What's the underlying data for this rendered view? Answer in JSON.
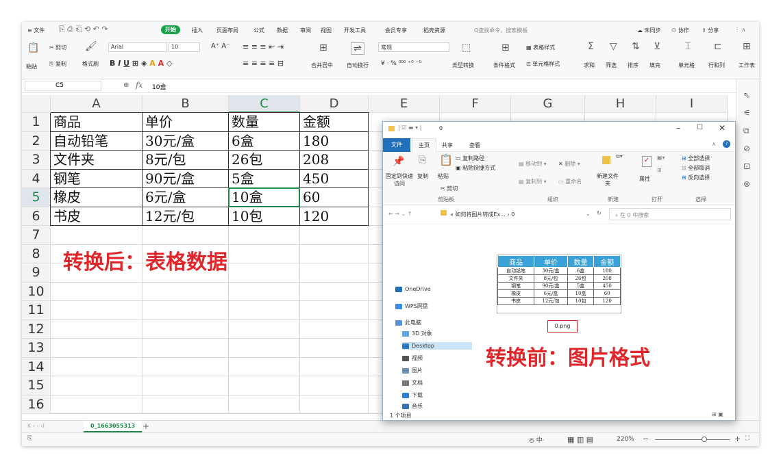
{
  "menubar": {
    "file_label": "≡ 文件",
    "start_label": "开始",
    "items": [
      "插入",
      "页面布局",
      "公式",
      "数据",
      "审阅",
      "视图",
      "开发工具",
      "会员专享",
      "稻壳资源"
    ],
    "search_placeholder": "Q查找命令、搜索模板",
    "sync_label": "未同步",
    "collab_label": "协作",
    "share_label": "分享"
  },
  "ribbon": {
    "paste_label": "粘贴",
    "cut_label": "剪切",
    "copy_label": "复制",
    "format_painter_label": "格式刷",
    "font_name": "Arial",
    "font_size": "10",
    "merge_label": "合并居中",
    "wrap_label": "自动换行",
    "number_format": "常规",
    "type_convert_label": "类型转换",
    "cond_format_label": "条件格式",
    "table_style_label": "表格样式",
    "cell_style_label": "单元格样式",
    "sum_label": "求和",
    "filter_label": "筛选",
    "sort_label": "排序",
    "fill_label": "填充",
    "cell_label": "单元格",
    "rowcol_label": "行和列",
    "worksheet_label": "工作表"
  },
  "formula": {
    "name_box": "C5",
    "fx": "fx",
    "content": "10盒"
  },
  "grid": {
    "columns": [
      "A",
      "B",
      "C",
      "D",
      "E",
      "F",
      "G",
      "H",
      "I"
    ],
    "rows": [
      "1",
      "2",
      "3",
      "4",
      "5",
      "6",
      "7",
      "8",
      "9",
      "10",
      "11",
      "12",
      "13",
      "14",
      "15",
      "16"
    ],
    "selected_col": "C",
    "selected_row": "5",
    "table": [
      [
        "商品",
        "单价",
        "数量",
        "金额"
      ],
      [
        "自动铅笔",
        "30元/盒",
        "6盒",
        "180"
      ],
      [
        "文件夹",
        "8元/包",
        "26包",
        "208"
      ],
      [
        "钢笔",
        "90元/盒",
        "5盒",
        "450"
      ],
      [
        "橡皮",
        "6元/盒",
        "10盒",
        "60"
      ],
      [
        "书皮",
        "12元/包",
        "10包",
        "120"
      ]
    ]
  },
  "annotation_after": "转换后：表格数据",
  "annotation_before": "转换前：图片格式",
  "sheet_tab": "0_1663055313",
  "add_sheet": "+",
  "status": {
    "zoom": "220%",
    "minus": "−",
    "plus": "+"
  },
  "explorer": {
    "title": "0",
    "tabs": [
      "文件",
      "主页",
      "共享",
      "查看"
    ],
    "ribbon": {
      "pin_label": "固定到快速访问",
      "copy_label": "复制",
      "paste_label": "粘贴",
      "copy_path_label": "复制路径",
      "paste_shortcut_label": "粘贴快捷方式",
      "cut_label": "剪切",
      "clipboard_group": "剪贴板",
      "move_to_label": "移动到",
      "copy_to_label": "复制到",
      "delete_label": "删除",
      "rename_label": "重命名",
      "organize_group": "组织",
      "new_folder_label": "新建文件夹",
      "new_group": "新建",
      "properties_label": "属性",
      "open_group": "打开",
      "select_all_label": "全部选择",
      "select_none_label": "全部取消",
      "invert_label": "反向选择",
      "select_group": "选择"
    },
    "address": "« 如何将图片转成Ex... › 0",
    "search_placeholder": "在 0 中搜索",
    "nav": [
      "OneDrive",
      "WPS网盘",
      "此电脑",
      "3D 对象",
      "Desktop",
      "视频",
      "图片",
      "文档",
      "下载",
      "音乐"
    ],
    "file_name": "0.png",
    "status_text": "1 个项目"
  },
  "thumbnail": {
    "header": [
      "商品",
      "单价",
      "数量",
      "金额"
    ],
    "rows": [
      [
        "自动铅笔",
        "30元/盒",
        "6盒",
        "180"
      ],
      [
        "文件夹",
        "8元/包",
        "26包",
        "208"
      ],
      [
        "钢笔",
        "90元/盒",
        "5盒",
        "450"
      ],
      [
        "橡皮",
        "6元/盒",
        "10盒",
        "60"
      ],
      [
        "书皮",
        "12元/包",
        "10包",
        "120"
      ]
    ]
  },
  "colors": {
    "accent_green": "#1aa44c",
    "annotation_red": "#e0262a",
    "thumb_header_blue": "#3aa0d8"
  }
}
